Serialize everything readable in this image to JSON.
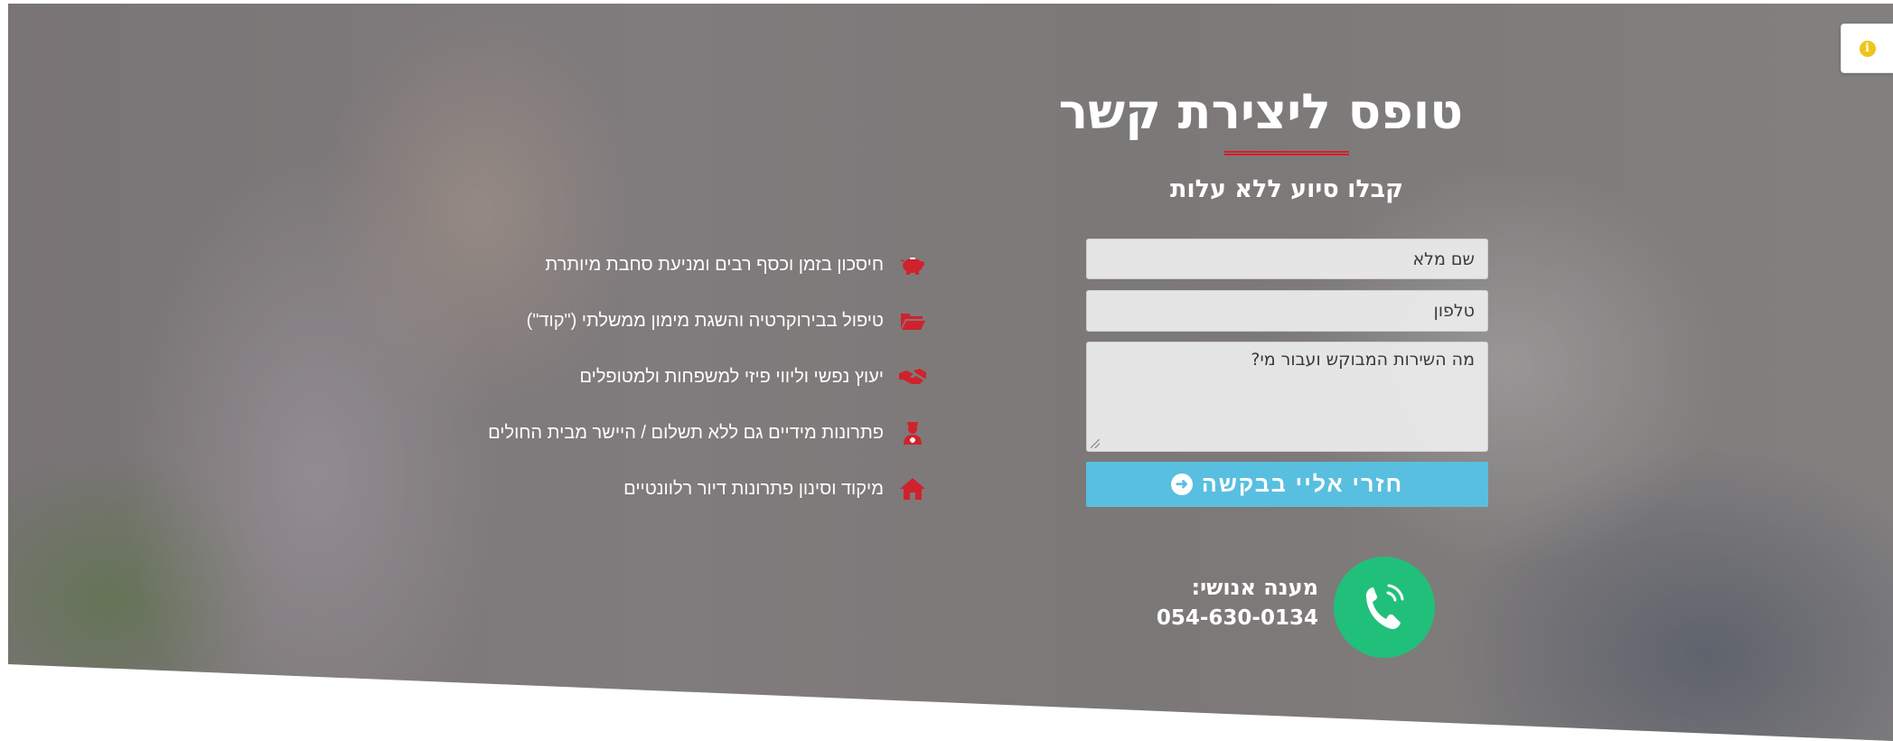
{
  "colors": {
    "accent_red": "#d0222c",
    "button_blue": "#59bfe0",
    "phone_green": "#21c07a",
    "info_yellow": "#f0c419"
  },
  "info_badge": {
    "icon": "info-icon"
  },
  "form": {
    "title": "טופס ליצירת קשר",
    "subtitle": "קבלו סיוע ללא עלות",
    "name_placeholder": "שם מלא",
    "phone_placeholder": "טלפון",
    "service_placeholder": "מה השירות המבוקש ועבור מי?",
    "submit_label": "חזרי אליי בבקשה",
    "submit_icon": "arrow-circle-left-icon"
  },
  "contact": {
    "label": "מענה אנושי:",
    "phone": "054-630-0134",
    "icon": "phone-ringing-icon"
  },
  "benefits": [
    {
      "icon": "piggy-bank-icon",
      "text": "חיסכון בזמן וכסף רבים ומניעת סחבת מיותרת"
    },
    {
      "icon": "folder-open-icon",
      "text": "טיפול בבירוקרטיה והשגת מימון ממשלתי (\"קוד\")"
    },
    {
      "icon": "handshake-icon",
      "text": "יעוץ נפשי וליווי פיזי למשפחות ולמטופלים"
    },
    {
      "icon": "user-nurse-icon",
      "text": "פתרונות מידיים גם ללא תשלום / היישר מבית החולים"
    },
    {
      "icon": "home-icon",
      "text": "מיקוד וסינון פתרונות דיור רלוונטיים"
    }
  ]
}
